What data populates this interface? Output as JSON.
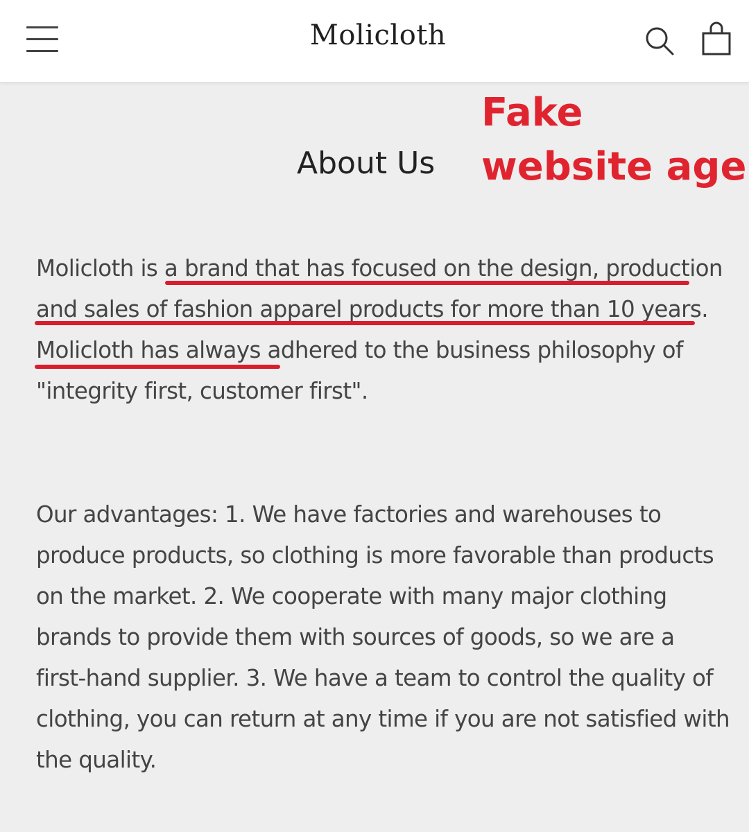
{
  "header": {
    "logo": "Molicloth",
    "menu_icon": "hamburger-menu-icon",
    "search_icon": "search-icon",
    "cart_icon": "shopping-bag-icon"
  },
  "page": {
    "title": "About Us"
  },
  "annotation": {
    "line1": "Fake",
    "line2": "website age",
    "color": "#e0242f"
  },
  "content": {
    "paragraph1": "Molicloth is a brand that has focused on the design, production and sales of fashion apparel products for more than 10 years. Molicloth has always adhered to the business philosophy of \"integrity first, customer first\".",
    "paragraph2": "Our advantages: 1. We have factories and warehouses to produce products, so clothing is more favorable than products on the market. 2. We cooperate with many major clothing brands to provide them with sources of goods, so we are a first-hand supplier. 3. We have a team to control the quality of clothing, you can return at any time if you are not satisfied with the quality."
  },
  "colors": {
    "header_bg": "#ffffff",
    "page_bg": "#eeeeee",
    "text": "#444444",
    "underline": "#d81e2c"
  }
}
